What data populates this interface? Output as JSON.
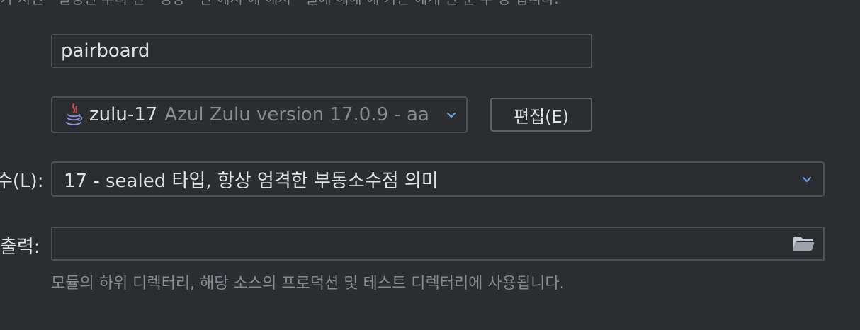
{
  "top_clipped_text": "가 지면 - 필정된 우리 한 - 경상 - 한 에서 에 해서 - 일에 해해 에 가는 에게 한 분 우 강 됩니다.",
  "module_name": {
    "value": "pairboard"
  },
  "jdk": {
    "name": "zulu-17",
    "detail": "Azul Zulu version 17.0.9 - aa",
    "edit_label": "편집(E)"
  },
  "language_level": {
    "label": "수(L):",
    "value": "17 - sealed 타입, 항상 엄격한 부동소수점 의미"
  },
  "compiler_output": {
    "label": "출력:",
    "value": "",
    "hint": "모듈의 하위 디렉터리, 해당 소스의 프로덕션 및 테스트 디렉터리에 사용됩니다."
  },
  "icons": {
    "jdk": "java-icon",
    "dropdown": "chevron-down-icon",
    "browse": "folder-icon"
  },
  "colors": {
    "background": "#2b2d30",
    "border": "#4e5157",
    "text": "#dfe1e5",
    "muted_text": "#868a91",
    "chevron": "#6aa7ee",
    "folder": "#c6cbd3"
  }
}
